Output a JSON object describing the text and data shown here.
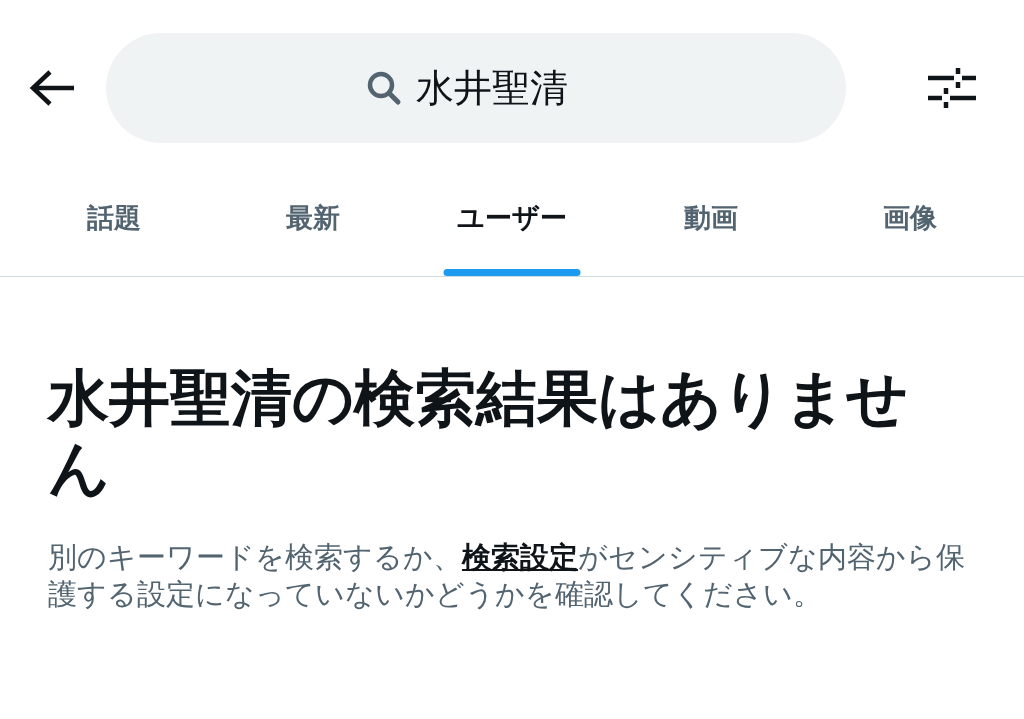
{
  "search": {
    "value": "水井聖清"
  },
  "tabs": [
    {
      "label": "話題",
      "selected": false
    },
    {
      "label": "最新",
      "selected": false
    },
    {
      "label": "ユーザー",
      "selected": true
    },
    {
      "label": "動画",
      "selected": false
    },
    {
      "label": "画像",
      "selected": false
    }
  ],
  "empty_state": {
    "title": "水井聖清の検索結果はありません",
    "message_before": "別のキーワードを検索するか、",
    "message_link": "検索設定",
    "message_after": "がセンシティブな内容から保護する設定になっていないかどうかを確認してください。"
  }
}
